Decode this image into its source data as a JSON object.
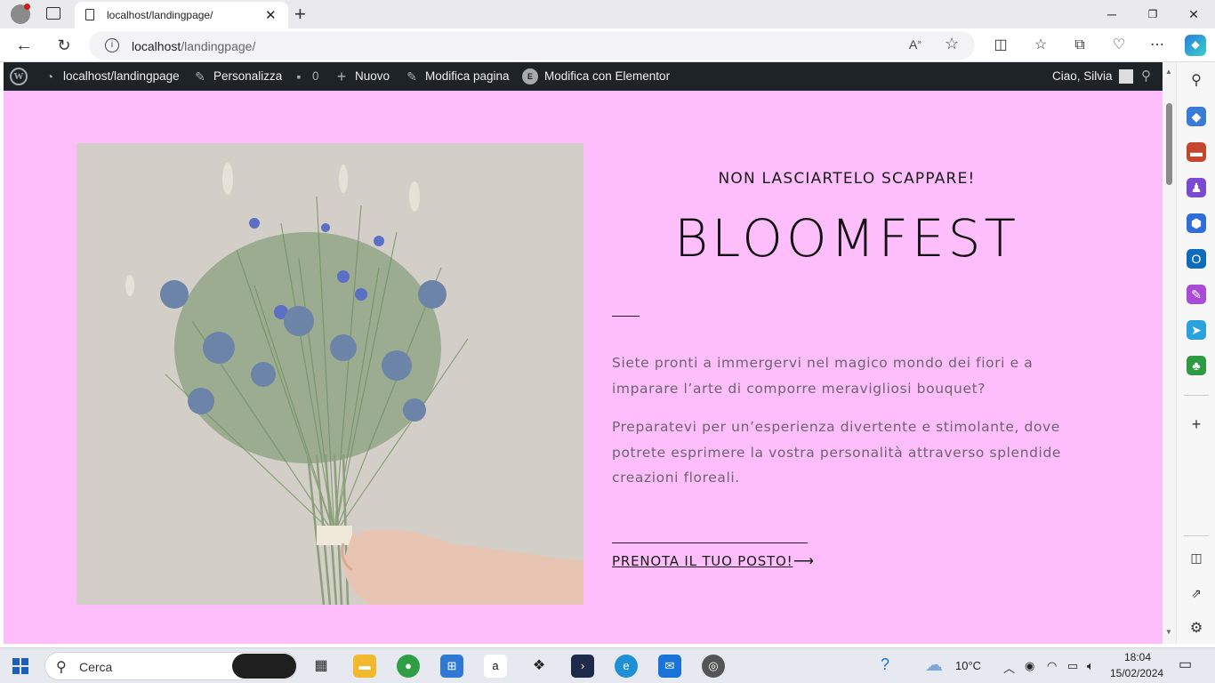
{
  "browser": {
    "tab_title": "localhost/landingpage/",
    "url_host": "localhost",
    "url_path": "/landingpage/",
    "new_tab_icon": "plus-icon",
    "close_tab_icon": "close-icon"
  },
  "wp_admin_bar": {
    "site_name": "localhost/landingpage",
    "customize": "Personalizza",
    "comments_count": "0",
    "new": "Nuovo",
    "edit_page": "Modifica pagina",
    "edit_elementor": "Modifica con Elementor",
    "greeting": "Ciao, Silvia"
  },
  "hero": {
    "eyebrow": "NON LASCIARTELO SCAPPARE!",
    "title": "BLOOMFEST",
    "paragraph1": "Siete pronti a immergervi nel magico mondo dei fiori e a imparare l’arte di comporre meravigliosi bouquet?",
    "paragraph2": "Preparatevi per un’esperienza divertente e stimolante, dove potrete esprimere la vostra personalità attraverso splendide creazioni floreali.",
    "cta": "PRENOTA IL TUO POSTO!",
    "background_color": "#fdbefb"
  },
  "taskbar": {
    "search_placeholder": "Cerca",
    "temperature": "10°C",
    "time": "18:04",
    "date": "15/02/2024"
  }
}
